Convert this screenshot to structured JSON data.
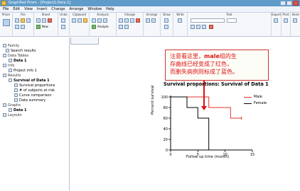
{
  "window": {
    "title": "GraphPad Prism - [Project1:Data 1]"
  },
  "menu": [
    "File",
    "Edit",
    "View",
    "Insert",
    "Change",
    "Arrange",
    "Window",
    "Help"
  ],
  "ribbon": {
    "groups": [
      "Prism",
      "File",
      "Sheet",
      "Undo",
      "Clipboard",
      "Analysis",
      "Change",
      "Arrange",
      "Draw",
      "Write",
      "Text",
      "Export",
      "Print",
      "Send"
    ],
    "new_label": "New",
    "analyze_label": "Analyze"
  },
  "sidebar": {
    "items": [
      {
        "label": "Family",
        "kind": "section"
      },
      {
        "label": "Search results",
        "kind": "item"
      },
      {
        "label": "Data Tables",
        "kind": "section"
      },
      {
        "label": "Data 1",
        "kind": "item",
        "bold": true
      },
      {
        "label": "Info",
        "kind": "section"
      },
      {
        "label": "Project info 1",
        "kind": "item"
      },
      {
        "label": "Results",
        "kind": "section"
      },
      {
        "label": "Survival of Data 1",
        "kind": "item",
        "bold": true
      },
      {
        "label": "Survival proportions",
        "kind": "sub"
      },
      {
        "label": "# of subjects at risk",
        "kind": "sub"
      },
      {
        "label": "Curve comparison",
        "kind": "sub"
      },
      {
        "label": "Data summary",
        "kind": "sub"
      },
      {
        "label": "Graphs",
        "kind": "section"
      },
      {
        "label": "Data 1",
        "kind": "item",
        "bold": true
      },
      {
        "label": "Layouts",
        "kind": "section"
      }
    ]
  },
  "annotation": {
    "line1_pre": "注意看这里，",
    "line1_kw": "male",
    "line1_post": "组的生",
    "line2": "存曲线已经变成了红色，",
    "line3": "而删失病例则标成了蓝色。"
  },
  "chart_data": {
    "type": "line",
    "title": "Survival proportions: Survival of Data 1",
    "xlabel": "Follow up time (month)",
    "ylabel": "Percent survival",
    "xlim": [
      0,
      15
    ],
    "ylim": [
      0,
      100
    ],
    "xticks": [
      0,
      5,
      10,
      15
    ],
    "yticks": [
      0,
      20,
      40,
      60,
      80,
      100
    ],
    "legend_position": "top-right",
    "series": [
      {
        "name": "Male",
        "color": "#e0322e",
        "steps": [
          [
            0,
            100
          ],
          [
            7,
            100
          ],
          [
            7,
            80
          ],
          [
            11,
            80
          ],
          [
            11,
            60
          ],
          [
            13,
            60
          ]
        ]
      },
      {
        "name": "Female",
        "color": "#000000",
        "steps": [
          [
            0,
            100
          ],
          [
            3,
            100
          ],
          [
            3,
            80
          ],
          [
            5,
            80
          ],
          [
            5,
            60
          ],
          [
            7,
            60
          ],
          [
            7,
            0
          ]
        ]
      }
    ]
  }
}
